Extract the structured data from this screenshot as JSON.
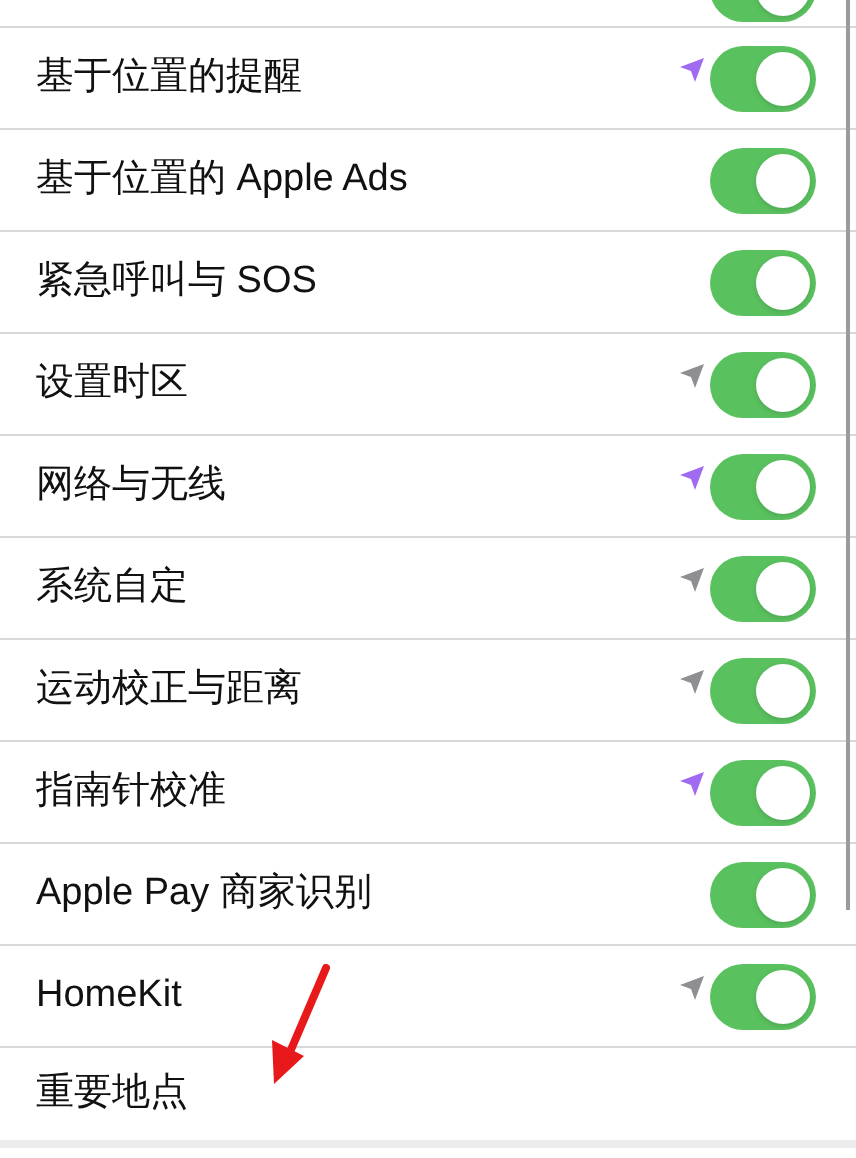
{
  "partial_top_row": {
    "on": true
  },
  "rows": [
    {
      "label": "基于位置的提醒",
      "location_icon": {
        "color": "#a06bf0"
      },
      "on": true
    },
    {
      "label": "基于位置的 Apple Ads",
      "on": true
    },
    {
      "label": "紧急呼叫与 SOS",
      "on": true
    },
    {
      "label": "设置时区",
      "location_icon": {
        "color": "#8e8e93"
      },
      "on": true
    },
    {
      "label": "网络与无线",
      "location_icon": {
        "color": "#a06bf0"
      },
      "on": true
    },
    {
      "label": "系统自定",
      "location_icon": {
        "color": "#8e8e93"
      },
      "on": true
    },
    {
      "label": "运动校正与距离",
      "location_icon": {
        "color": "#8e8e93"
      },
      "on": true
    },
    {
      "label": "指南针校准",
      "location_icon": {
        "color": "#a06bf0"
      },
      "on": true
    },
    {
      "label": "Apple Pay 商家识别",
      "on": true
    },
    {
      "label": "HomeKit",
      "location_icon": {
        "color": "#8e8e93"
      },
      "on": true
    }
  ],
  "last_row": {
    "label": "重要地点"
  }
}
